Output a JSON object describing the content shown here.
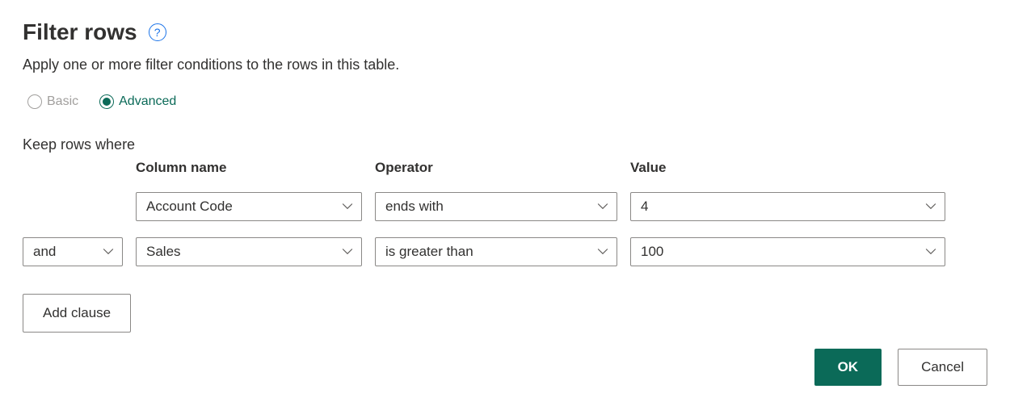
{
  "header": {
    "title": "Filter rows",
    "subtitle": "Apply one or more filter conditions to the rows in this table.",
    "help_tooltip": "?"
  },
  "mode": {
    "basic_label": "Basic",
    "advanced_label": "Advanced",
    "selected": "advanced"
  },
  "filter": {
    "keep_label": "Keep rows where",
    "columns": {
      "name_header": "Column name",
      "operator_header": "Operator",
      "value_header": "Value"
    },
    "rows": [
      {
        "logic": "",
        "column": "Account Code",
        "operator": "ends with",
        "value": "4"
      },
      {
        "logic": "and",
        "column": "Sales",
        "operator": "is greater than",
        "value": "100"
      }
    ],
    "add_clause_label": "Add clause"
  },
  "footer": {
    "ok_label": "OK",
    "cancel_label": "Cancel"
  }
}
